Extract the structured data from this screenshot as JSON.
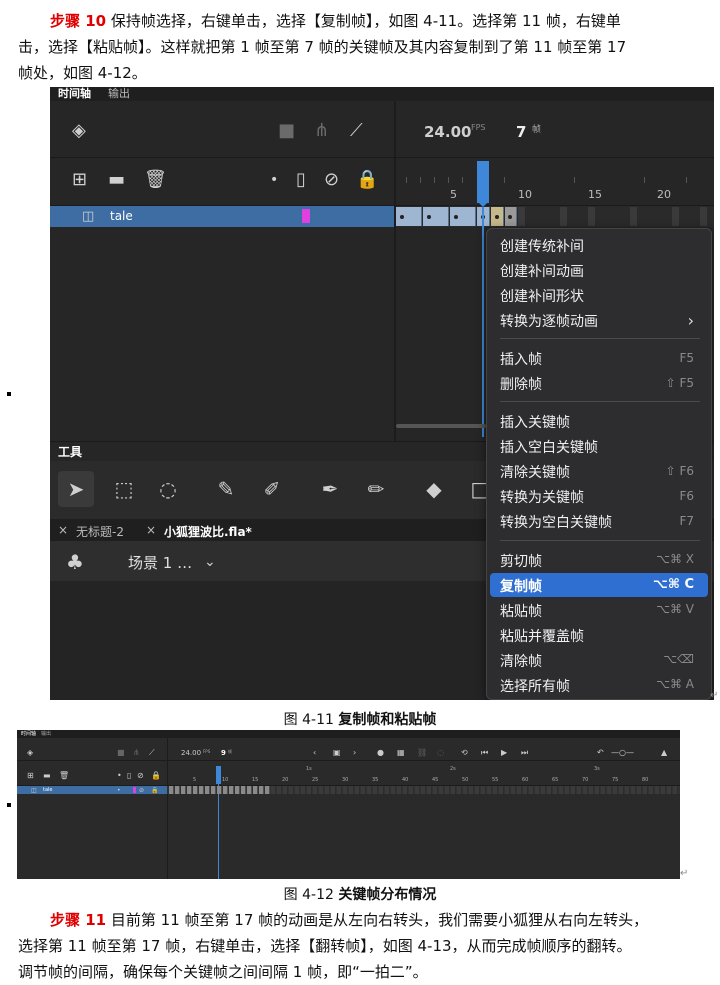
{
  "step10": {
    "label": "步骤 10",
    "line1": "保持帧选择，右键单击，选择【复制帧】，如图 4-11。选择第 11 帧，右键单",
    "line2": "击，选择【粘贴帧】。这样就把第 1 帧至第 7 帧的关键帧及其内容复制到了第 11 帧至第 17",
    "line3": "帧处，如图 4-12。"
  },
  "fig1": {
    "tabs": [
      "时间轴",
      "输出"
    ],
    "fps_value": "24.00",
    "fps_unit": "FPS",
    "frame_value": "7",
    "frame_unit": "帧",
    "ruler": [
      "5",
      "10",
      "15",
      "20"
    ],
    "layer_name": "tale",
    "tools_title": "工具",
    "doc_tabs": [
      "无标题-2",
      "小狐狸波比.fla*"
    ],
    "scene": "场景 1 …",
    "menu": {
      "group1": [
        {
          "label": "创建传统补间",
          "shortcut": ""
        },
        {
          "label": "创建补间动画",
          "shortcut": ""
        },
        {
          "label": "创建补间形状",
          "shortcut": ""
        },
        {
          "label": "转换为逐帧动画",
          "shortcut": "›"
        }
      ],
      "group2": [
        {
          "label": "插入帧",
          "shortcut": "F5"
        },
        {
          "label": "删除帧",
          "shortcut": "⇧ F5"
        }
      ],
      "group3": [
        {
          "label": "插入关键帧",
          "shortcut": ""
        },
        {
          "label": "插入空白关键帧",
          "shortcut": ""
        },
        {
          "label": "清除关键帧",
          "shortcut": "⇧ F6"
        },
        {
          "label": "转换为关键帧",
          "shortcut": "F6"
        },
        {
          "label": "转换为空白关键帧",
          "shortcut": "F7"
        }
      ],
      "group4": [
        {
          "label": "剪切帧",
          "shortcut": "⌥⌘ X"
        },
        {
          "label": "复制帧",
          "shortcut": "⌥⌘ C",
          "highlighted": true
        },
        {
          "label": "粘贴帧",
          "shortcut": "⌥⌘ V"
        },
        {
          "label": "粘贴并覆盖帧",
          "shortcut": ""
        },
        {
          "label": "清除帧",
          "shortcut": "⌥⌫"
        },
        {
          "label": "选择所有帧",
          "shortcut": "⌥⌘ A"
        }
      ]
    },
    "highlight_color": "#2f6fd1",
    "layer_color": "#e040e0"
  },
  "caption1": {
    "num": "图  4-11",
    "title": "复制帧和粘贴帧"
  },
  "fig2": {
    "tabs": [
      "时间轴",
      "输出"
    ],
    "fps_value": "24.00",
    "fps_unit": "FPS",
    "frame_value": "9",
    "frame_unit": "帧",
    "layer_name": "tale",
    "ruler": [
      "5",
      "10",
      "15",
      "20",
      "25",
      "30",
      "35",
      "40",
      "45",
      "50",
      "55",
      "60",
      "65",
      "70",
      "75",
      "80"
    ],
    "seconds": [
      "1s",
      "2s",
      "3s"
    ]
  },
  "caption2": {
    "num": "图  4-12",
    "title": "关键帧分布情况"
  },
  "step11": {
    "label": "步骤 11",
    "line1": "目前第 11 帧至第 17 帧的动画是从左向右转头，我们需要小狐狸从右向左转头，",
    "line2": "选择第 11 帧至第 17 帧，右键单击，选择【翻转帧】，如图 4-13，从而完成帧顺序的翻转。",
    "line3": "调节帧的间隔，确保每个关键帧之间间隔 1 帧，即“一拍二”。"
  }
}
